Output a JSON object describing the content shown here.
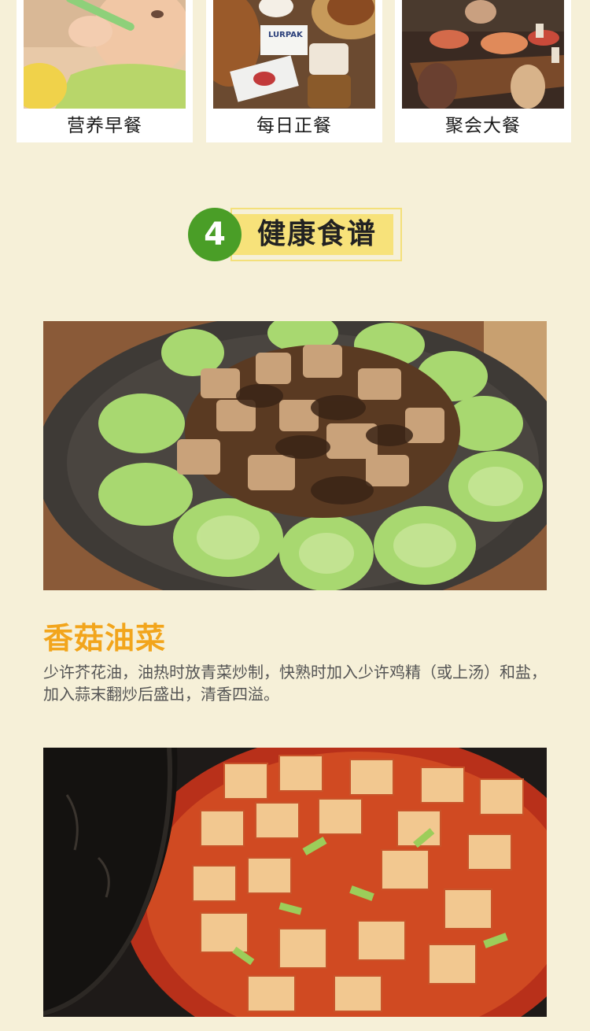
{
  "meal_cards": [
    {
      "label": "营养早餐"
    },
    {
      "label": "每日正餐"
    },
    {
      "label": "聚会大餐"
    }
  ],
  "section": {
    "number": "4",
    "title": "健康食谱"
  },
  "recipes": [
    {
      "title": "香菇油菜",
      "description": "少许芥花油，油热时放青菜炒制，快熟时加入少许鸡精（或上汤）和盐，加入蒜末翻炒后盛出，清香四溢。"
    }
  ],
  "photo_text": {
    "butter_brand": "LURPAK"
  },
  "colors": {
    "background": "#f6f0d8",
    "badge_green": "#4a9e27",
    "heading_bar_yellow": "#f7e27a",
    "recipe_title_orange": "#f2a51c"
  }
}
